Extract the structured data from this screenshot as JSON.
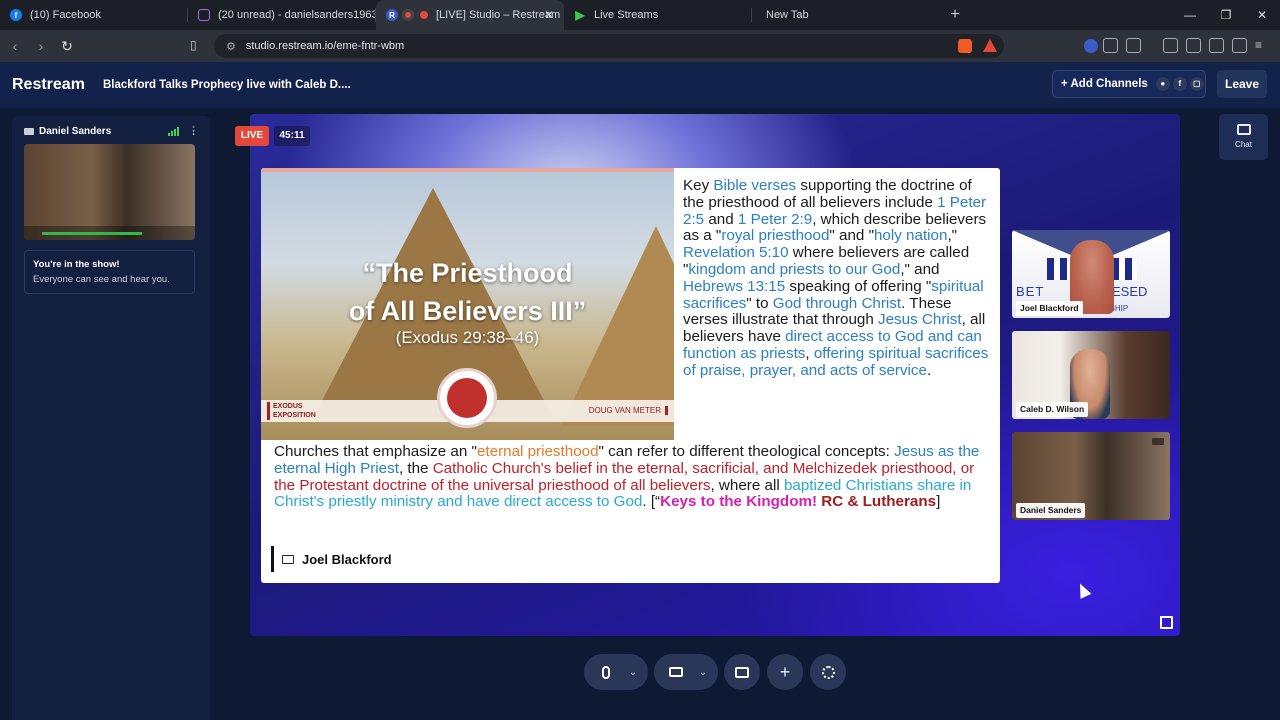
{
  "browser": {
    "tabs": [
      {
        "label": "(10) Facebook",
        "icon": "facebook-icon",
        "color": "#1877f2"
      },
      {
        "label": "(20 unread) - danielsanders1963@ya",
        "icon": "mail-icon",
        "color": "#7b3fe4"
      },
      {
        "label": "[LIVE] Studio – Restream",
        "icon": "restream-icon",
        "color": "#e5473b",
        "active": true
      },
      {
        "label": "Live Streams",
        "icon": "play-icon",
        "color": "#3fc94b"
      },
      {
        "label": "New Tab",
        "icon": "",
        "color": ""
      }
    ],
    "url": "studio.restream.io/eme-fntr-wbm"
  },
  "app": {
    "logo": "Restream",
    "stream_title": "Blackford Talks Prophecy live with Caleb D....",
    "add_channels_label": "+ Add Channels",
    "leave_label": "Leave",
    "chat_label": "Chat"
  },
  "left_panel": {
    "camera_name": "Daniel Sanders",
    "show_title": "You're in the show!",
    "show_subtitle": "Everyone can see and hear you."
  },
  "stage": {
    "live_label": "LIVE",
    "timer": "45:11",
    "slide": {
      "title_line1": "“The Priesthood",
      "title_line2": "of All Believers III”",
      "subtitle": "(Exodus 29:38–46)",
      "banner_left_line1": "EXODUS",
      "banner_left_line2": "EXPOSITION",
      "banner_right": "DOUG VAN METER",
      "presenter": "Joel Blackford"
    },
    "guests": [
      {
        "name": "Joel Blackford"
      },
      {
        "name": "Caleb D. Wilson"
      },
      {
        "name": "Daniel Sanders"
      }
    ],
    "guest1_logo_left": "BET",
    "guest1_logo_right": "ESED",
    "guest1_logo_bottom": "WSHIP"
  },
  "colors": {
    "accent_live": "#e5473b",
    "header_bg": "#13224a",
    "slide_blue": "#2b7fc2",
    "slide_cyan": "#29a8d6",
    "slide_red": "#c0202a",
    "slide_orange": "#e27b2c",
    "slide_magenta": "#d61fb0"
  }
}
